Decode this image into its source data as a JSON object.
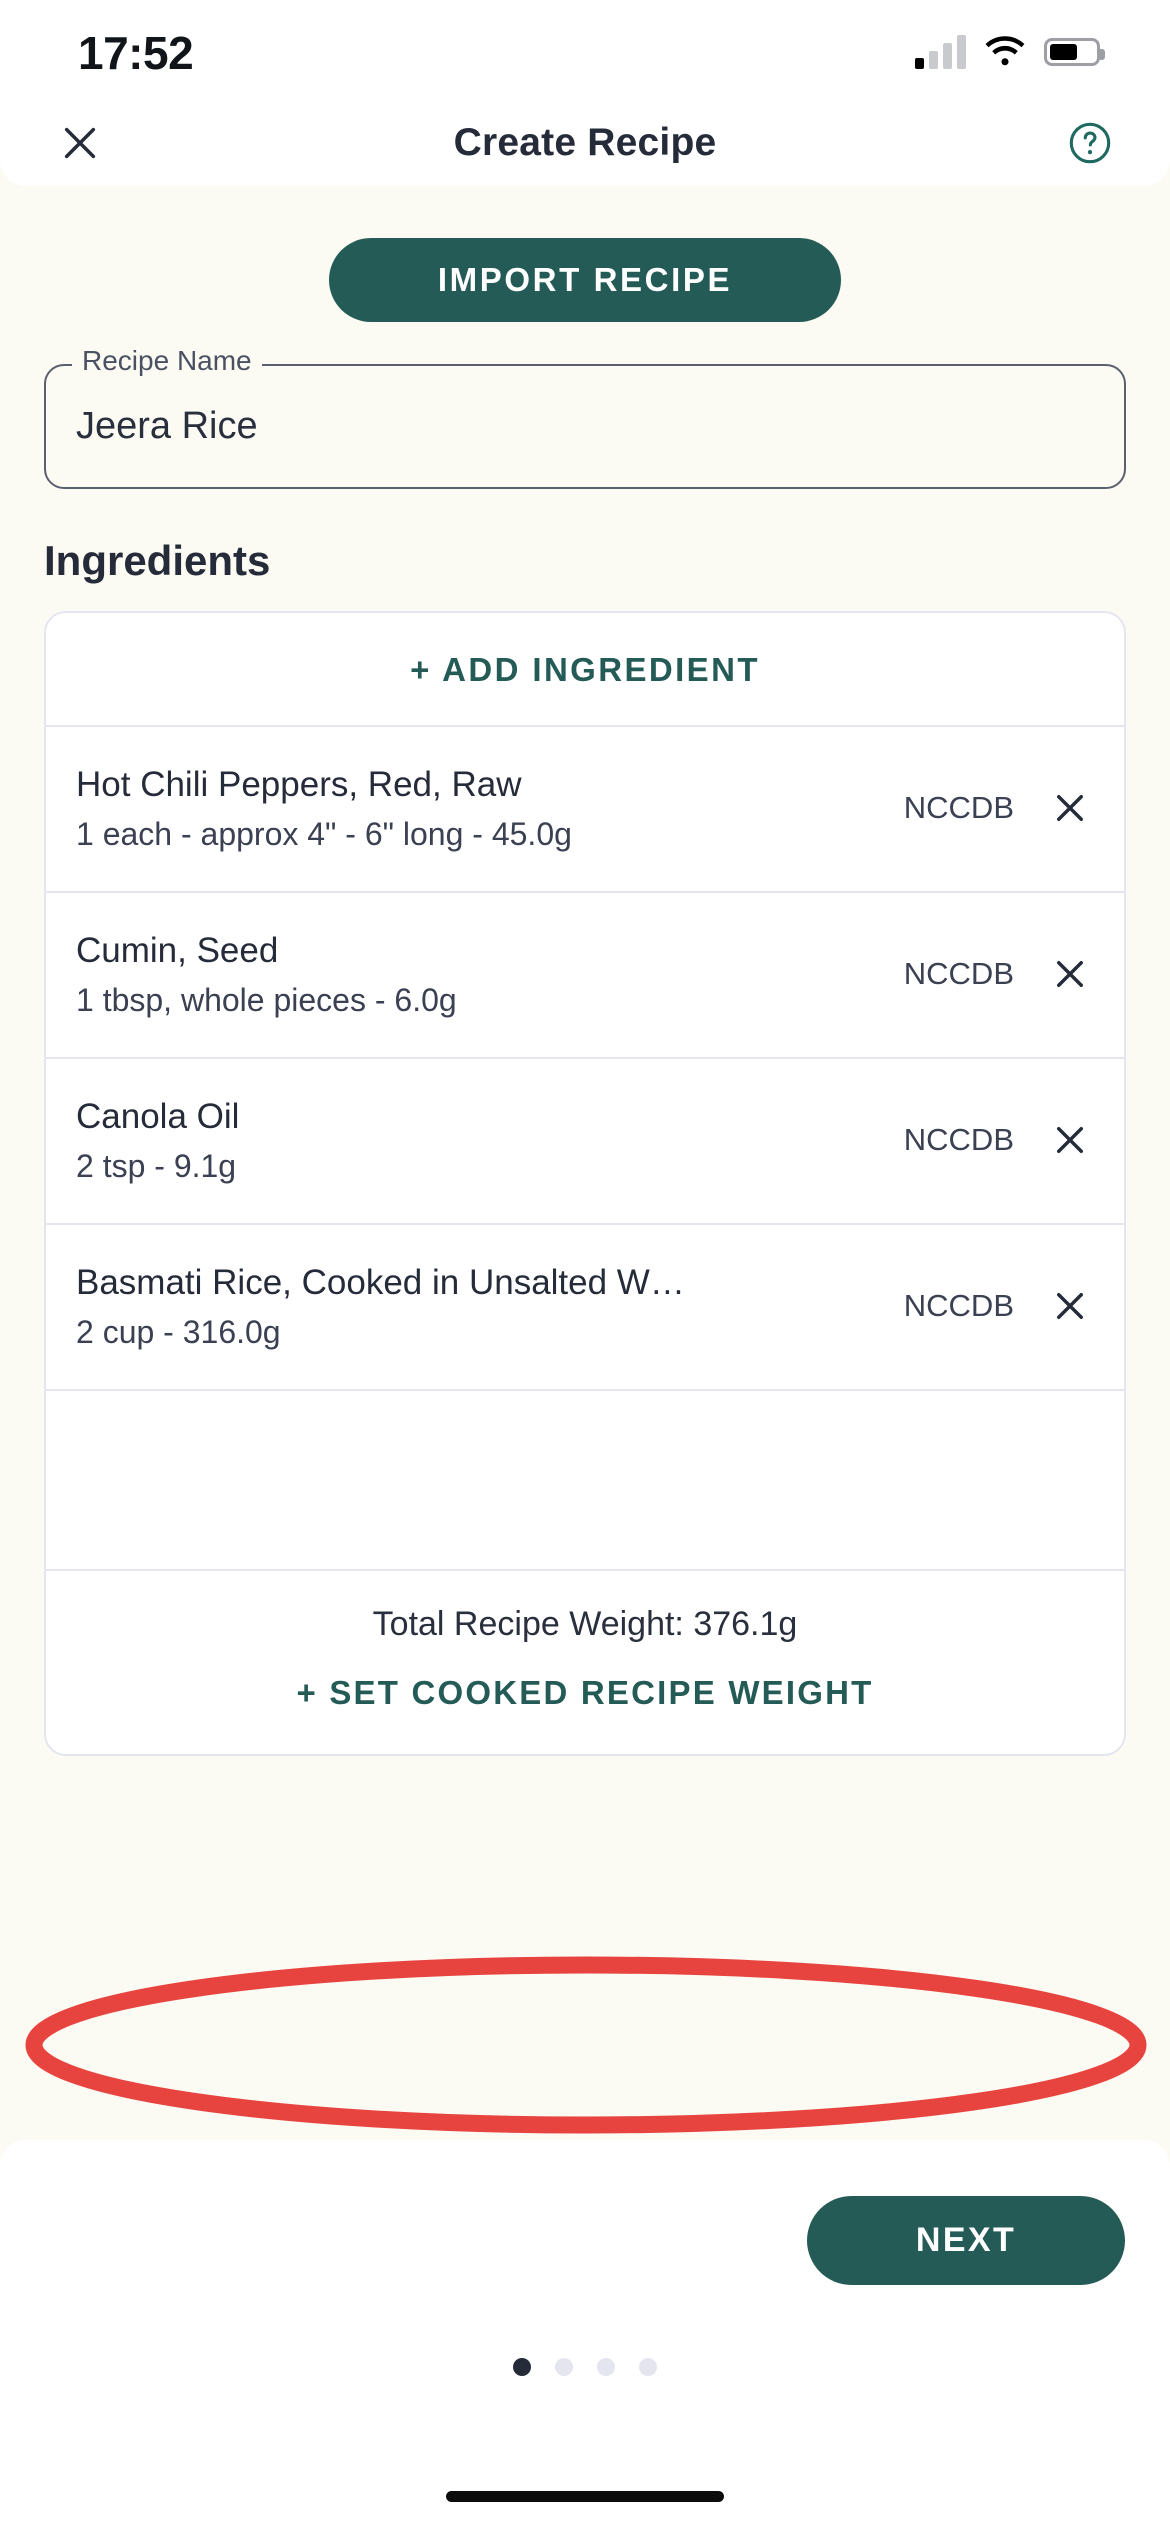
{
  "status_bar": {
    "time": "17:52",
    "signal_icon": "cellular-signal-icon",
    "signal_bars_filled": 1,
    "signal_bars_total": 4,
    "wifi_icon": "wifi-icon",
    "battery_icon": "battery-icon",
    "battery_level_percent": 62
  },
  "header": {
    "close_icon": "close-icon",
    "title": "Create Recipe",
    "help_icon": "help-circle-icon"
  },
  "main": {
    "import_button": "IMPORT RECIPE",
    "recipe_name_field": {
      "label": "Recipe Name",
      "value": "Jeera Rice",
      "placeholder": "Recipe Name"
    },
    "ingredients_section_title": "Ingredients",
    "add_ingredient_button": "+ ADD INGREDIENT",
    "ingredients": [
      {
        "name": "Hot Chili Peppers, Red, Raw",
        "detail": "1 each - approx 4\" - 6\" long - 45.0g",
        "source": "NCCDB",
        "remove_icon": "close-icon"
      },
      {
        "name": "Cumin, Seed",
        "detail": "1 tbsp, whole pieces - 6.0g",
        "source": "NCCDB",
        "remove_icon": "close-icon"
      },
      {
        "name": "Canola Oil",
        "detail": "2 tsp - 9.1g",
        "source": "NCCDB",
        "remove_icon": "close-icon"
      },
      {
        "name": "Basmati Rice, Cooked in Unsalted W…",
        "detail": "2 cup - 316.0g",
        "source": "NCCDB",
        "remove_icon": "close-icon"
      }
    ],
    "total_recipe_weight": "Total Recipe Weight: 376.1g",
    "set_cooked_weight_button": "+ SET COOKED RECIPE WEIGHT"
  },
  "annotation": {
    "shape": "ellipse-highlight",
    "color": "#E8443F",
    "targets": "set_cooked_weight_button"
  },
  "footer": {
    "next_button": "NEXT",
    "page_dots_total": 4,
    "page_dots_active_index": 0
  },
  "colors": {
    "background": "#FBFAF3",
    "surface": "#FFFFFF",
    "primary_teal": "#245B56",
    "text_dark": "#262B3A",
    "border": "#E4E5EF",
    "annotation_red": "#E8443F"
  }
}
